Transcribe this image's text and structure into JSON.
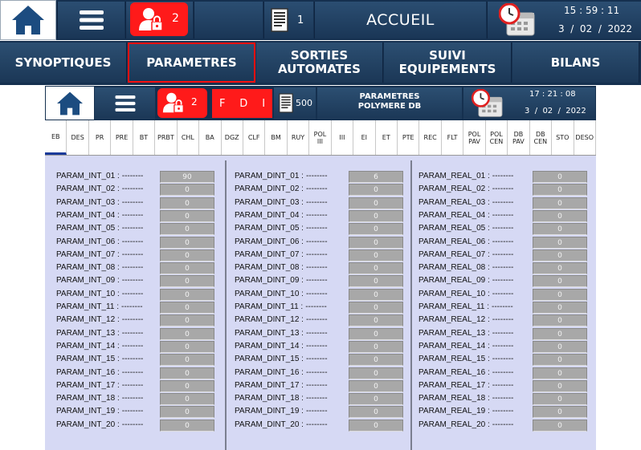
{
  "header": {
    "alarm_count": "2",
    "doc_count": "1",
    "title": "ACCUEIL",
    "time": "15 : 59 : 11",
    "date": "3  /  02  /  2022"
  },
  "menu": [
    {
      "label": "SYNOPTIQUES"
    },
    {
      "label": "PARAMETRES"
    },
    {
      "label": "SORTIES\nAUTOMATES"
    },
    {
      "label": "SUIVI\nEQUIPEMENTS"
    },
    {
      "label": "BILANS"
    }
  ],
  "inner": {
    "alarm_count": "2",
    "flags": [
      "F",
      "D",
      "I"
    ],
    "doc_count": "500",
    "title_line1": "PARAMETRES",
    "title_line2": "POLYMERE DB",
    "time": "17 : 21 : 08",
    "date": "3  /  02  /  2022"
  },
  "tabs": [
    "EB",
    "DES",
    "PR",
    "PRE",
    "BT",
    "PRBT",
    "CHL",
    "BA",
    "DGZ",
    "CLF",
    "BM",
    "RUY",
    "POL\nIII",
    "III",
    "EI",
    "ET",
    "PTE",
    "REC",
    "FLT",
    "POL\nPAV",
    "POL\nCEN",
    "DB\nPAV",
    "DB\nCEN",
    "STO",
    "DESO"
  ],
  "columns": [
    {
      "labels": [
        "PARAM_INT_01 :",
        "PARAM_INT_02 :",
        "PARAM_INT_03 :",
        "PARAM_INT_04 :",
        "PARAM_INT_05 :",
        "PARAM_INT_06 :",
        "PARAM_INT_07 :",
        "PARAM_INT_08 :",
        "PARAM_INT_09 :",
        "PARAM_INT_10 :",
        "PARAM_INT_11 :",
        "PARAM_INT_12 :",
        "PARAM_INT_13 :",
        "PARAM_INT_14 :",
        "PARAM_INT_15 :",
        "PARAM_INT_16 :",
        "PARAM_INT_17 :",
        "PARAM_INT_18 :",
        "PARAM_INT_19 :",
        "PARAM_INT_20 :"
      ],
      "values": [
        "90",
        "0",
        "0",
        "0",
        "0",
        "0",
        "0",
        "0",
        "0",
        "0",
        "0",
        "0",
        "0",
        "0",
        "0",
        "0",
        "0",
        "0",
        "0",
        "0"
      ]
    },
    {
      "labels": [
        "PARAM_DINT_01 :",
        "PARAM_DINT_02 :",
        "PARAM_DINT_03 :",
        "PARAM_DINT_04 :",
        "PARAM_DINT_05 :",
        "PARAM_DINT_06 :",
        "PARAM_DINT_07 :",
        "PARAM_DINT_08 :",
        "PARAM_DINT_09 :",
        "PARAM_DINT_10 :",
        "PARAM_DINT_11 :",
        "PARAM_DINT_12 :",
        "PARAM_DINT_13 :",
        "PARAM_DINT_14 :",
        "PARAM_DINT_15 :",
        "PARAM_DINT_16 :",
        "PARAM_DINT_17 :",
        "PARAM_DINT_18 :",
        "PARAM_DINT_19 :",
        "PARAM_DINT_20 :"
      ],
      "values": [
        "6",
        "0",
        "0",
        "0",
        "0",
        "0",
        "0",
        "0",
        "0",
        "0",
        "0",
        "0",
        "0",
        "0",
        "0",
        "0",
        "0",
        "0",
        "0",
        "0"
      ]
    },
    {
      "labels": [
        "PARAM_REAL_01 :",
        "PARAM_REAL_02 :",
        "PARAM_REAL_03 :",
        "PARAM_REAL_04 :",
        "PARAM_REAL_05 :",
        "PARAM_REAL_06 :",
        "PARAM_REAL_07 :",
        "PARAM_REAL_08 :",
        "PARAM_REAL_09 :",
        "PARAM_REAL_10 :",
        "PARAM_REAL_11 :",
        "PARAM_REAL_12 :",
        "PARAM_REAL_13 :",
        "PARAM_REAL_14 :",
        "PARAM_REAL_15 :",
        "PARAM_REAL_16 :",
        "PARAM_REAL_17 :",
        "PARAM_REAL_18 :",
        "PARAM_REAL_19 :",
        "PARAM_REAL_20 :"
      ],
      "values": [
        "0",
        "0",
        "0",
        "0",
        "0",
        "0",
        "0",
        "0",
        "0",
        "0",
        "0",
        "0",
        "0",
        "0",
        "0",
        "0",
        "0",
        "0",
        "0",
        "0"
      ]
    }
  ],
  "dashes": "--------",
  "colors": {
    "navy": "#1b3756",
    "alarm_red": "#ff1a1a",
    "panel_bg": "#d6d9f4",
    "value_bg": "#a8a8a8",
    "active_tab": "#1a3a9a"
  },
  "icons": {
    "home": "home-icon",
    "menu": "hamburger-icon",
    "user": "user-lock-icon",
    "doc": "document-icon",
    "calendar": "clock-calendar-icon"
  }
}
